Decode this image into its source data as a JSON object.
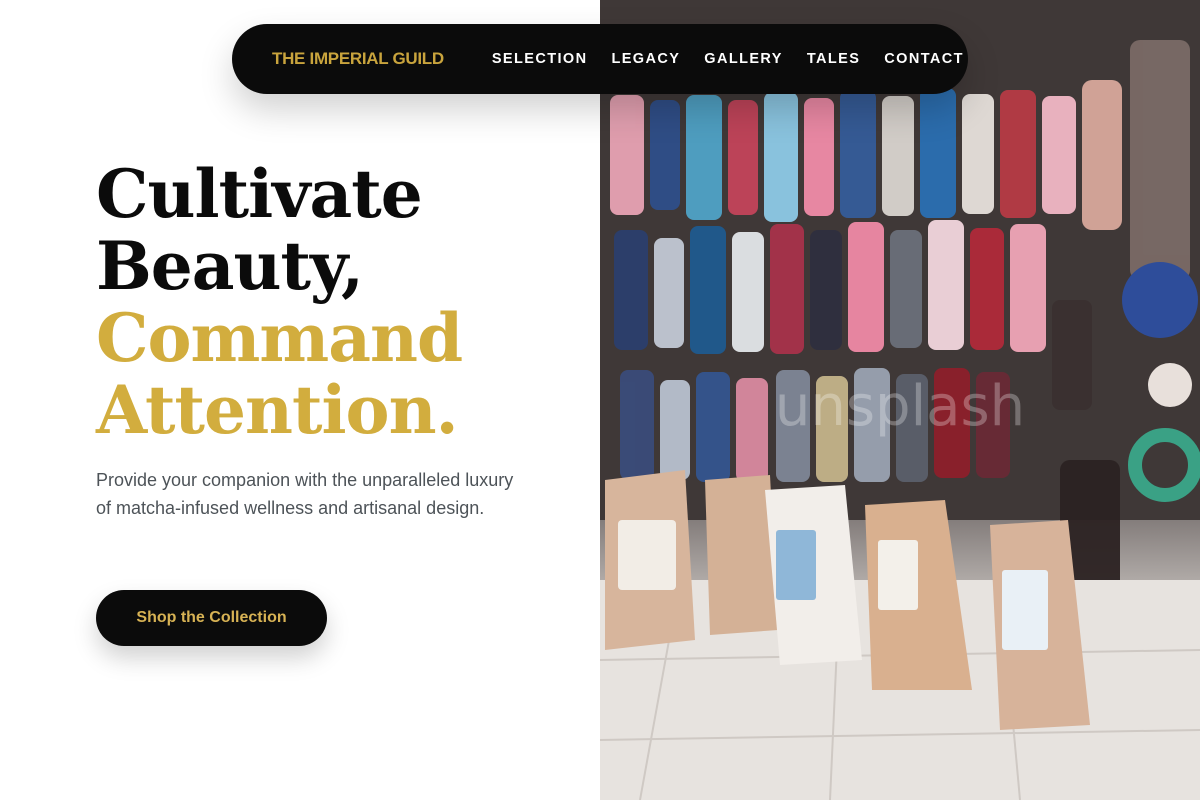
{
  "brand": {
    "name": "THE IMPERIAL GUILD",
    "color": "#c9a43d"
  },
  "nav": {
    "links": [
      {
        "label": "SELECTION"
      },
      {
        "label": "LEGACY"
      },
      {
        "label": "GALLERY"
      },
      {
        "label": "TALES"
      },
      {
        "label": "CONTACT"
      }
    ]
  },
  "hero": {
    "headline_line1": "Cultivate",
    "headline_line2": "Beauty,",
    "headline_line3": "Command",
    "headline_line4": "Attention.",
    "lead": "Provide your companion with the unparalleled luxury of matcha-infused wellness and artisanal design.",
    "cta_label": "Shop the Collection",
    "image_watermark": "unsplash"
  },
  "colors": {
    "nav_bg": "#0b0b0b",
    "gold": "#d2ad3e",
    "text_dark": "#0b0b0b",
    "text_muted": "#4d5358"
  }
}
